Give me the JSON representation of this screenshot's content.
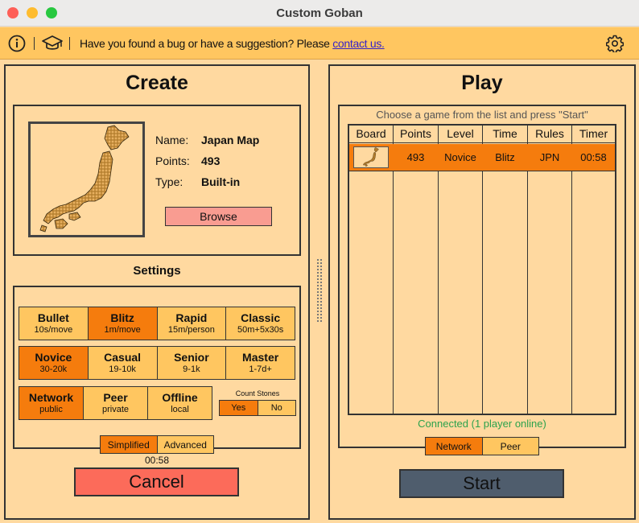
{
  "window": {
    "title": "Custom Goban"
  },
  "infobar": {
    "message": "Have you found a bug or have a suggestion? Please ",
    "link": "contact us."
  },
  "create": {
    "title": "Create",
    "map": {
      "name_label": "Name:",
      "name": "Japan Map",
      "points_label": "Points:",
      "points": "493",
      "type_label": "Type:",
      "type": "Built-in"
    },
    "browse_label": "Browse",
    "settings_title": "Settings",
    "time_options": [
      {
        "title": "Bullet",
        "sub": "10s/move"
      },
      {
        "title": "Blitz",
        "sub": "1m/move"
      },
      {
        "title": "Rapid",
        "sub": "15m/person"
      },
      {
        "title": "Classic",
        "sub": "50m+5x30s"
      }
    ],
    "level_options": [
      {
        "title": "Novice",
        "sub": "30-20k"
      },
      {
        "title": "Casual",
        "sub": "19-10k"
      },
      {
        "title": "Senior",
        "sub": "9-1k"
      },
      {
        "title": "Master",
        "sub": "1-7d+"
      }
    ],
    "mode_options": [
      {
        "title": "Network",
        "sub": "public"
      },
      {
        "title": "Peer",
        "sub": "private"
      },
      {
        "title": "Offline",
        "sub": "local"
      }
    ],
    "count_stones": {
      "label": "Count Stones",
      "yes": "Yes",
      "no": "No"
    },
    "view_mode": {
      "simplified": "Simplified",
      "advanced": "Advanced"
    },
    "timer": "00:58",
    "cancel_label": "Cancel"
  },
  "play": {
    "title": "Play",
    "hint": "Choose a game from the list and press \"Start\"",
    "columns": [
      "Board",
      "Points",
      "Level",
      "Time",
      "Rules",
      "Timer"
    ],
    "rows": [
      {
        "points": "493",
        "level": "Novice",
        "time": "Blitz",
        "rules": "JPN",
        "timer": "00:58"
      }
    ],
    "status": "Connected (1 player online)",
    "network_tabs": {
      "network": "Network",
      "peer": "Peer"
    },
    "start_label": "Start"
  },
  "colors": {
    "background": "#ffd9a0",
    "infobar": "#ffc660",
    "selected": "#f57c0d",
    "cancel": "#fc6b5a",
    "start": "#4f5d6d",
    "connected": "#2ba24c",
    "link": "#3522c9"
  }
}
